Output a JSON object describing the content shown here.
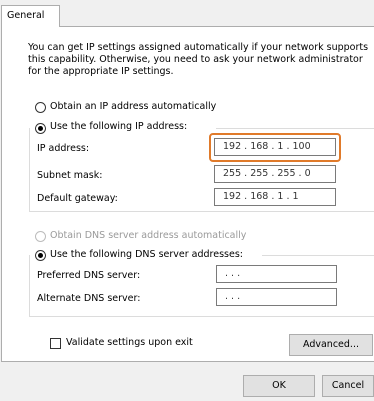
{
  "tabs": [
    {
      "label": "General"
    }
  ],
  "description": "You can get IP settings assigned automatically if your network supports this capability. Otherwise, you need to ask your network administrator for the appropriate IP settings.",
  "ip_mode": {
    "auto_label": "Obtain an IP address automatically",
    "manual_label": "Use the following IP address:",
    "selected": "manual"
  },
  "ip_fields": [
    {
      "label": "IP address:",
      "value": "192 . 168 .  1  . 100"
    },
    {
      "label": "Subnet mask:",
      "value": "255 . 255 . 255 .  0"
    },
    {
      "label": "Default gateway:",
      "value": "192 . 168 .  1  .  1"
    }
  ],
  "dns_mode": {
    "auto_label": "Obtain DNS server address automatically",
    "manual_label": "Use the following DNS server addresses:",
    "selected": "manual"
  },
  "dns_fields": [
    {
      "label": "Preferred DNS server:",
      "value": " .      .      ."
    },
    {
      "label": "Alternate DNS server:",
      "value": " .      .      ."
    }
  ],
  "validate_label": "Validate settings upon exit",
  "validate_checked": false,
  "buttons": {
    "advanced": "Advanced...",
    "ok": "OK",
    "cancel": "Cancel"
  },
  "colors": {
    "highlight": "#e07a2a"
  }
}
